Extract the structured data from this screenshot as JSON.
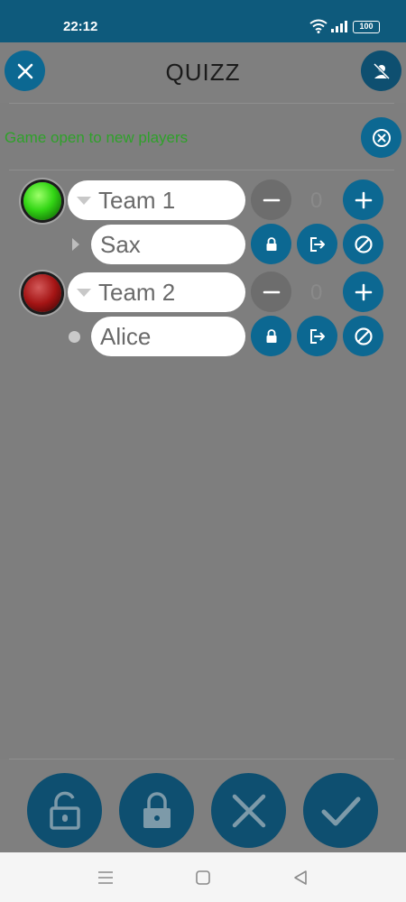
{
  "status_bar": {
    "time": "22:12",
    "battery": "100"
  },
  "header": {
    "title": "QUIZZ"
  },
  "game_status": {
    "text": "Game open to new players",
    "color": "#2fa12a"
  },
  "teams": [
    {
      "name": "Team 1",
      "score": "0",
      "led_color": "green",
      "players": [
        {
          "name": "Sax"
        }
      ]
    },
    {
      "name": "Team 2",
      "score": "0",
      "led_color": "red",
      "players": [
        {
          "name": "Alice"
        }
      ]
    }
  ],
  "colors": {
    "accent": "#0c6892",
    "dark_accent": "#0e4f70",
    "background": "#7e7e7e",
    "status_bar": "#0e5a7c"
  },
  "icons": {
    "close": "close-icon",
    "no_person": "person-off-icon",
    "close_circle": "close-circle-icon",
    "minus": "minus-icon",
    "plus": "plus-icon",
    "lock": "lock-icon",
    "exit": "exit-icon",
    "block": "block-icon",
    "unlock": "unlock-icon",
    "check": "check-icon"
  }
}
